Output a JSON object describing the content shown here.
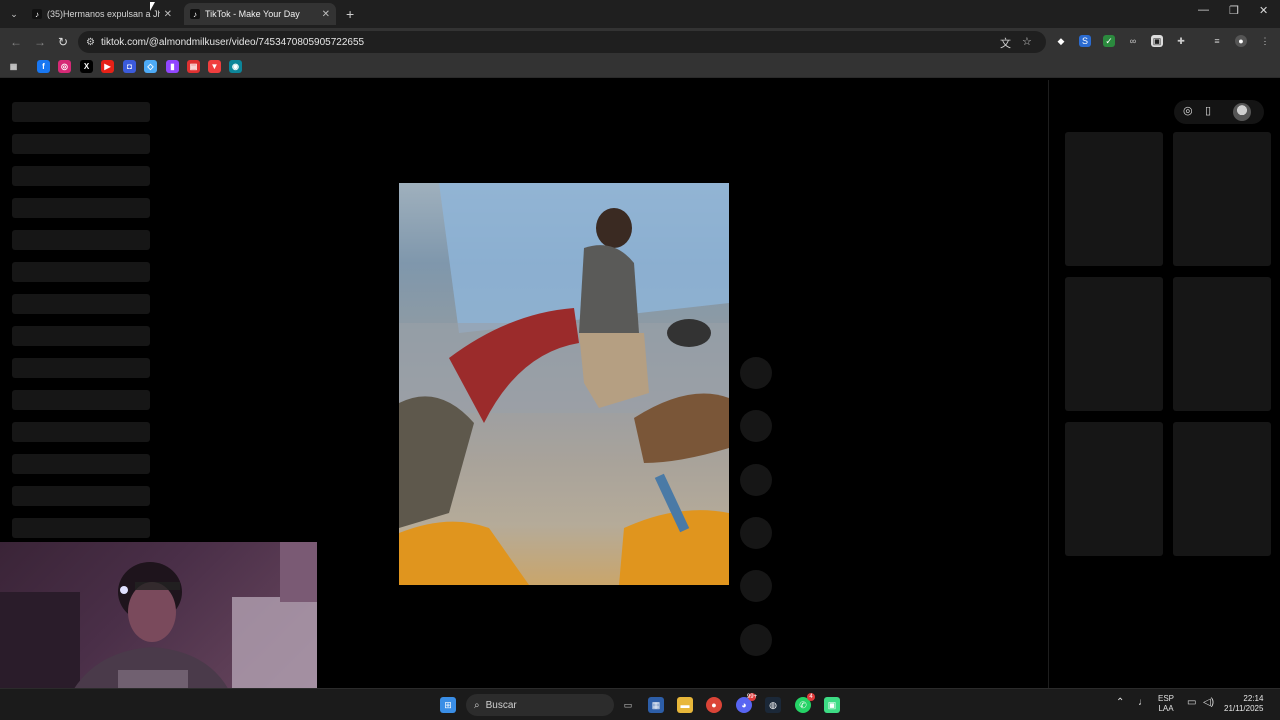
{
  "browser": {
    "tabs": [
      {
        "title": "(35)Hermanos expulsan a Jho...",
        "active": false
      },
      {
        "title": "TikTok - Make Your Day",
        "active": true
      }
    ],
    "url": "tiktok.com/@almondmilkuser/video/7453470805905722655"
  },
  "taskbar": {
    "search_label": "Buscar",
    "lang_line1": "ESP",
    "lang_line2": "LAA",
    "time": "22:14",
    "date": "21/11/2025",
    "discord_badge": "99+",
    "whatsapp_badge": "4"
  },
  "colors": {
    "page_bg": "#000000",
    "skeleton": "#161616",
    "toolbar": "#333333",
    "tabstrip": "#1f1f1f"
  }
}
